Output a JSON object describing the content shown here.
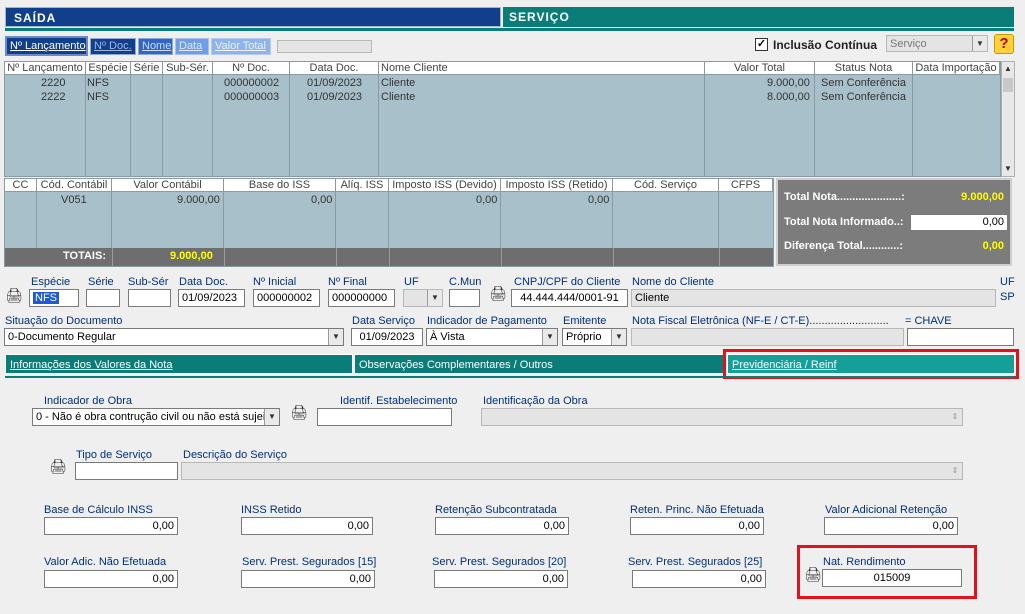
{
  "header": {
    "left_title": "SAÍDA",
    "right_title": "SERVIÇO"
  },
  "toolbar": {
    "buttons": [
      "Nº Lançamento",
      "Nº Doc.",
      "Nome",
      "Data",
      "Valor Total"
    ],
    "inclusao_continua_label": "Inclusão Contínua",
    "inclusao_continua_checked": true,
    "tipo_select_value": "Serviço",
    "help_icon": "question-mark"
  },
  "launch_grid": {
    "columns": [
      "Nº Lançamento",
      "Espécie",
      "Série",
      "Sub-Sér.",
      "Nº Doc.",
      "Data Doc.",
      "Nome Cliente",
      "Valor Total",
      "Status Nota",
      "Data Importação"
    ],
    "rows": [
      {
        "lancamento": "2220",
        "especie": "NFS",
        "serie": "",
        "subserie": "",
        "doc": "000000002",
        "data": "01/09/2023",
        "cliente": "Cliente",
        "valor": "9.000,00",
        "status": "Sem Conferência",
        "importacao": ""
      },
      {
        "lancamento": "2222",
        "especie": "NFS",
        "serie": "",
        "subserie": "",
        "doc": "000000003",
        "data": "01/09/2023",
        "cliente": "Cliente",
        "valor": "8.000,00",
        "status": "Sem Conferência",
        "importacao": ""
      }
    ]
  },
  "tax_grid": {
    "columns": [
      "CC",
      "Cód. Contábil",
      "Valor Contábil",
      "Base do ISS",
      "Alíq. ISS",
      "Imposto ISS (Devido)",
      "Imposto ISS (Retido)",
      "Cód. Serviço",
      "CFPS"
    ],
    "row": {
      "cc": "",
      "cod_contabil": "V051",
      "valor_contabil": "9.000,00",
      "base_iss": "0,00",
      "aliq_iss": "",
      "iss_devido": "0,00",
      "iss_retido": "0,00",
      "cod_servico": "",
      "cfps": ""
    },
    "totals_label": "TOTAIS:",
    "totals_value": "9.000,00"
  },
  "summary": {
    "total_nota_label": "Total Nota.....................:",
    "total_nota_value": "9.000,00",
    "total_informado_label": "Total Nota Informado..:",
    "total_informado_value": "0,00",
    "diferenca_label": "Diferença Total............:",
    "diferenca_value": "0,00"
  },
  "document": {
    "especie_label": "Espécie",
    "especie_value": "NFS",
    "serie_label": "Série",
    "serie_value": "",
    "subser_label": "Sub-Sér",
    "subser_value": "",
    "data_doc_label": "Data Doc.",
    "data_doc_value": "01/09/2023",
    "n_inicial_label": "Nº Inicial",
    "n_inicial_value": "000000002",
    "n_final_label": "Nº Final",
    "n_final_value": "000000000",
    "uf_label": "UF",
    "uf_value": "",
    "cmun_label": "C.Mun",
    "cmun_value": "",
    "cnpj_label": "CNPJ/CPF do Cliente",
    "cnpj_value": "44.444.444/0001-91",
    "nome_cliente_label": "Nome do Cliente",
    "nome_cliente_value": "Cliente",
    "uf2_label": "UF",
    "uf2_value": "SP",
    "situacao_label": "Situação do Documento",
    "situacao_value": "0-Documento Regular",
    "data_servico_label": "Data Serviço",
    "data_servico_value": "01/09/2023",
    "indicador_pagamento_label": "Indicador de Pagamento",
    "indicador_pagamento_value": "À Vista",
    "emitente_label": "Emitente",
    "emitente_value": "Próprio",
    "nfe_label": "Nota Fiscal Eletrônica (NF-E / CT-E)..........................",
    "chave_label": "=  CHAVE",
    "nfe_value": "",
    "chave_value": ""
  },
  "tabs": [
    {
      "label": "Informações dos Valores da Nota"
    },
    {
      "label": "Observações Complementares / Outros"
    },
    {
      "label": "Previdenciária / Reinf"
    }
  ],
  "reinf": {
    "indicador_obra_label": "Indicador de Obra",
    "indicador_obra_value": "0 - Não é obra contrução civil ou não está sujeit",
    "identif_estab_label": "Identif. Estabelecimento",
    "identif_estab_value": "",
    "identificacao_obra_label": "Identificação da Obra",
    "identificacao_obra_value": "",
    "tipo_servico_label": "Tipo de Serviço",
    "tipo_servico_value": "",
    "descricao_servico_label": "Descrição do Serviço",
    "descricao_servico_value": "",
    "base_calculo_label": "Base de Cálculo INSS",
    "base_calculo_value": "0,00",
    "inss_retido_label": "INSS Retido",
    "inss_retido_value": "0,00",
    "retencao_sub_label": "Retenção Subcontratada",
    "retencao_sub_value": "0,00",
    "reten_princ_label": "Reten. Princ. Não Efetuada",
    "reten_princ_value": "0,00",
    "valor_adic_ret_label": "Valor Adicional Retenção",
    "valor_adic_ret_value": "0,00",
    "valor_adic_nao_label": "Valor Adic. Não Efetuada",
    "valor_adic_nao_value": "0,00",
    "serv15_label": "Serv. Prest. Segurados [15]",
    "serv15_value": "0,00",
    "serv20_label": "Serv. Prest. Segurados [20]",
    "serv20_value": "0,00",
    "serv25_label": "Serv. Prest. Segurados [25]",
    "serv25_value": "0,00",
    "nat_rendimento_label": "Nat. Rendimento",
    "nat_rendimento_value": "015009"
  },
  "colors": {
    "header_blue": "#123f8c",
    "teal": "#0b7d78",
    "grid_bg": "#a8c0ca",
    "highlight_red": "#e0131d",
    "totals_yellow": "#ffff00"
  }
}
